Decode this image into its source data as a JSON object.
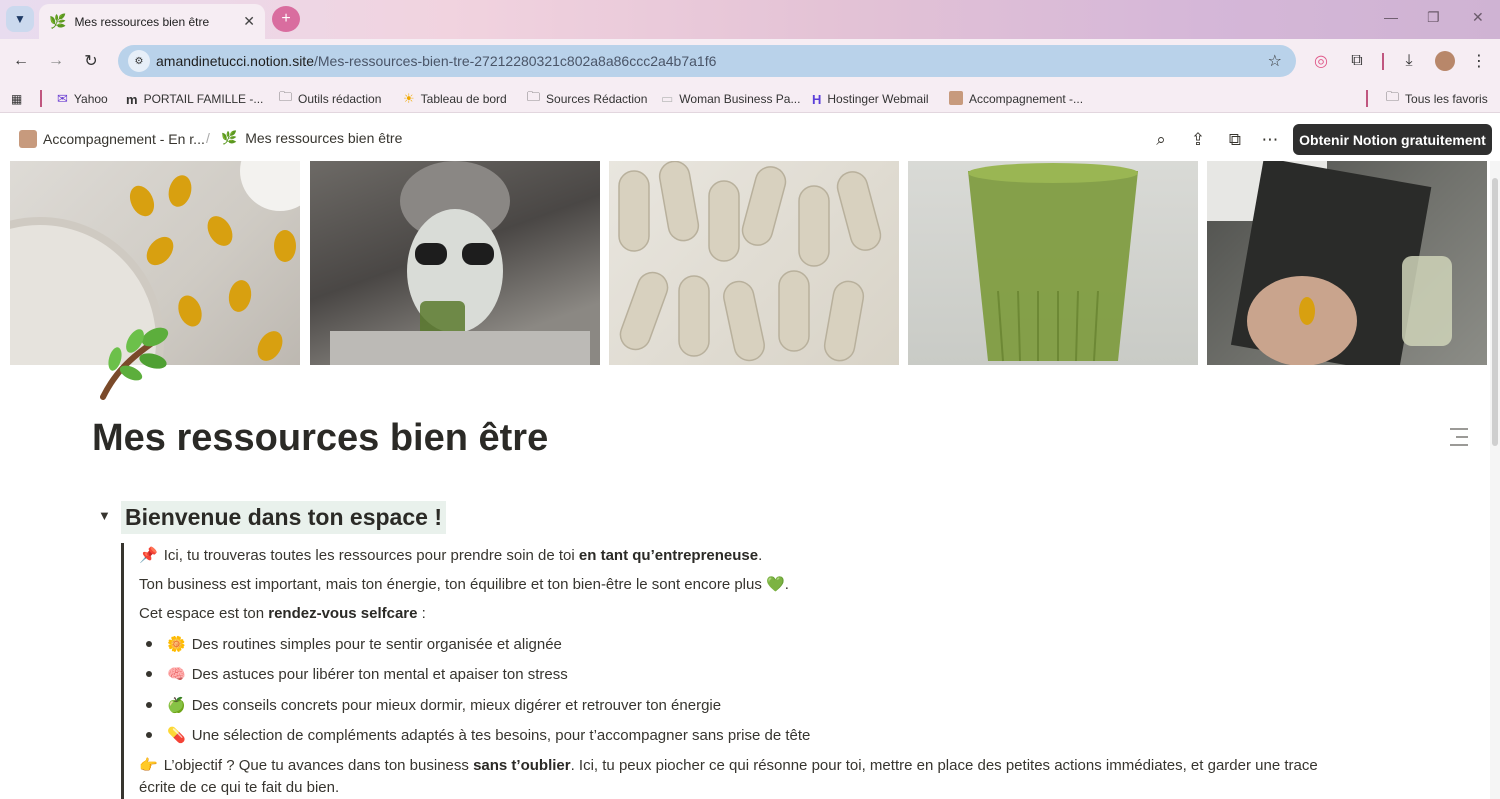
{
  "browser": {
    "tab": {
      "title": "Mes ressources bien être"
    },
    "omnibox": {
      "host": "amandinetucci.notion.site",
      "path": "/Mes-ressources-bien-tre-27212280321c802a8a86ccc2a4b7a1f6"
    },
    "bookmarks": [
      {
        "label": "Yahoo",
        "icon": "mail-icon"
      },
      {
        "label": "PORTAIL FAMILLE -...",
        "icon": "m-logo-icon"
      },
      {
        "label": "Outils rédaction",
        "icon": "folder-icon"
      },
      {
        "label": "Tableau de bord",
        "icon": "sun-icon"
      },
      {
        "label": "Sources Rédaction",
        "icon": "folder-icon"
      },
      {
        "label": "Woman Business Pa...",
        "icon": "page-icon"
      },
      {
        "label": "Hostinger Webmail",
        "icon": "hostinger-icon"
      },
      {
        "label": "Accompagnement -...",
        "icon": "avatar-icon"
      }
    ],
    "all_bookmarks_label": "Tous les favoris"
  },
  "notion": {
    "breadcrumb": [
      {
        "label": "Accompagnement - En r..."
      },
      {
        "label": "Mes ressources bien être"
      }
    ],
    "cta_label": "Obtenir Notion gratuitement",
    "page_title": "Mes ressources bien être",
    "heading": "Bienvenue dans ton espace !",
    "intro": {
      "emoji": "📌",
      "pre": "Ici, tu trouveras toutes les ressources pour prendre soin de toi ",
      "bold": "en tant qu’entrepreneuse",
      "post": "."
    },
    "line2": {
      "text": "Ton business est important, mais ton énergie, ton équilibre et ton bien-être le sont encore plus ",
      "emoji": "💚",
      "post": "."
    },
    "line3": {
      "pre": "Cet espace est ton ",
      "bold": "rendez-vous selfcare",
      "post": " :"
    },
    "bullets": [
      {
        "emoji": "🌼",
        "text": "Des routines simples pour te sentir organisée et alignée"
      },
      {
        "emoji": "🧠",
        "text": "Des astuces pour libérer ton mental et apaiser ton stress"
      },
      {
        "emoji": "🍏",
        "text": "Des conseils concrets pour mieux dormir, mieux digérer et retrouver ton énergie"
      },
      {
        "emoji": "💊",
        "text": "Une sélection de compléments adaptés à tes besoins, pour t’accompagner sans prise de tête"
      }
    ],
    "objective": {
      "emoji": "👉",
      "pre": "L’objectif ? Que tu avances dans ton business ",
      "bold": "sans t’oublier",
      "post": ". Ici, tu peux piocher ce qui résonne pour toi, mettre en place des petites actions immédiates, et garder une trace",
      "line2": "écrite de ce qui te fait du bien."
    }
  }
}
